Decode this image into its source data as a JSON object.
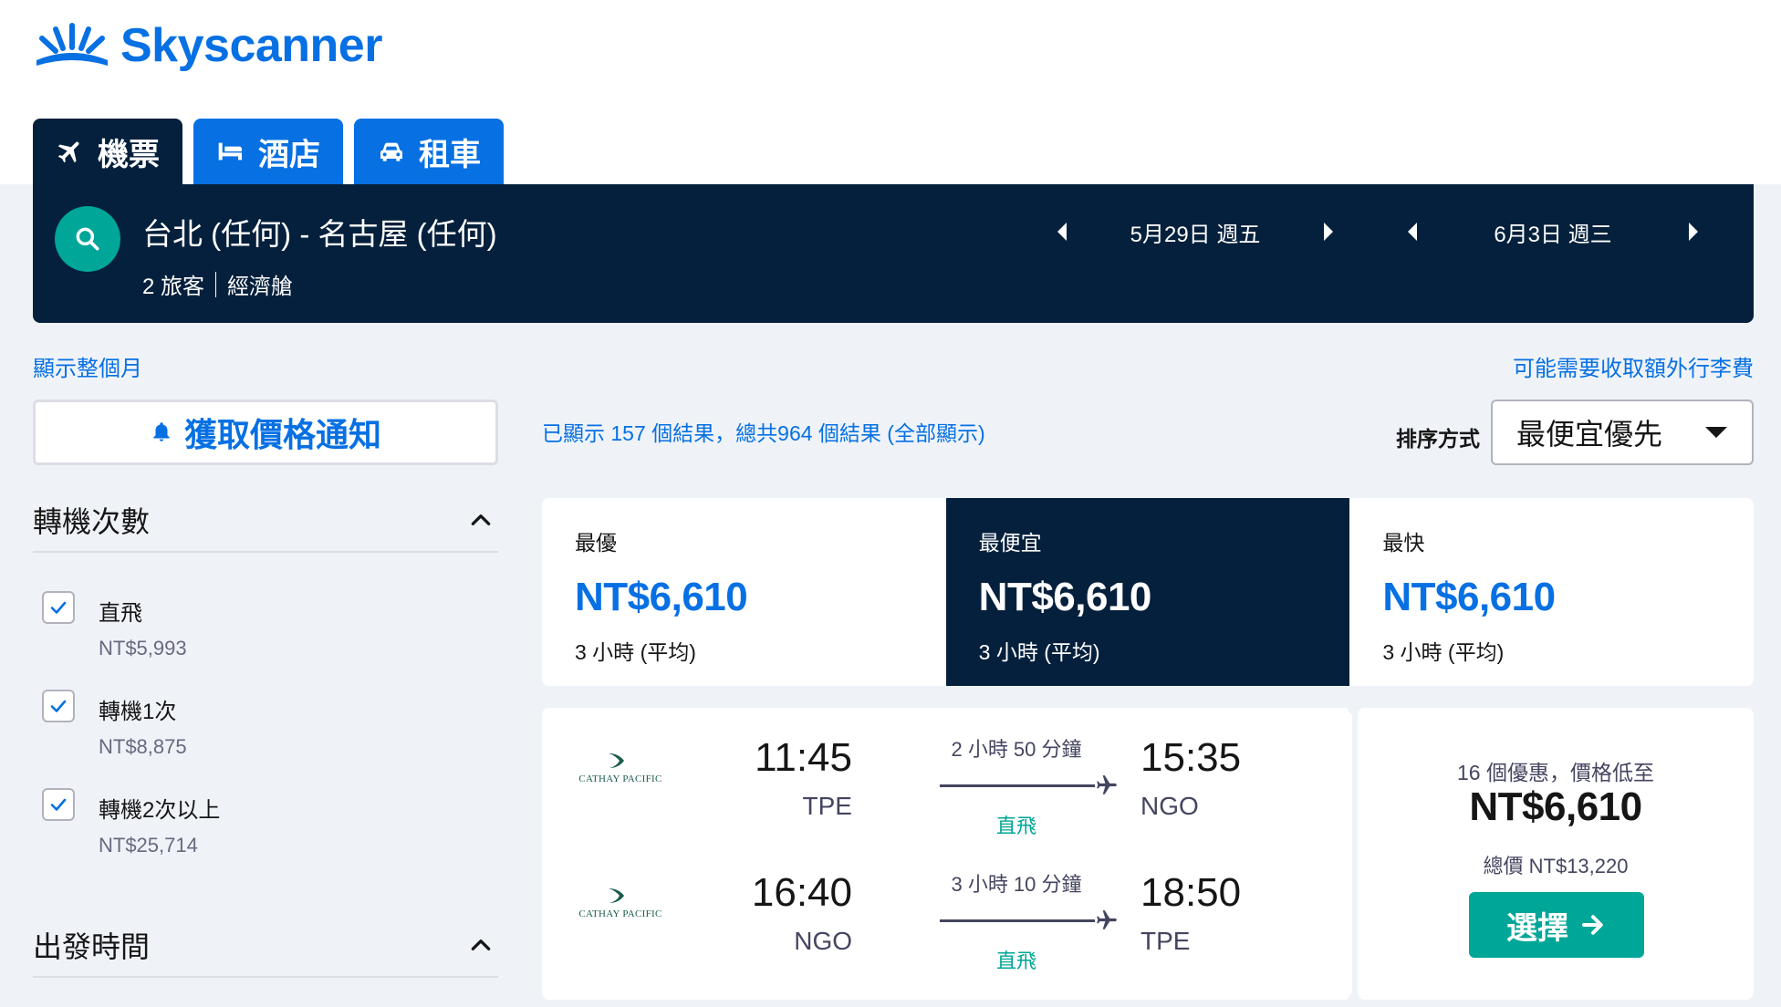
{
  "brand": {
    "name": "Skyscanner",
    "color": "#0770e3"
  },
  "tabs": [
    {
      "label": "機票",
      "icon": "plane-icon",
      "active": true
    },
    {
      "label": "酒店",
      "icon": "bed-icon",
      "active": false
    },
    {
      "label": "租車",
      "icon": "car-icon",
      "active": false
    }
  ],
  "search": {
    "route": "台北 (任何) - 名古屋 (任何)",
    "travelers": "2 旅客",
    "cabin": "經濟艙",
    "depart_date": "5月29日 週五",
    "return_date": "6月3日 週三"
  },
  "links": {
    "show_month": "顯示整個月",
    "baggage_fee": "可能需要收取額外行李費"
  },
  "price_alert": {
    "label": "獲取價格通知"
  },
  "results": {
    "count_text": "已顯示 157 個結果，總共964 個結果 (全部顯示)",
    "sort_label": "排序方式",
    "sort_value": "最便宜優先"
  },
  "filters": {
    "stops_title": "轉機次數",
    "stops": [
      {
        "label": "直飛",
        "price": "NT$5,993",
        "checked": true
      },
      {
        "label": "轉機1次",
        "price": "NT$8,875",
        "checked": true
      },
      {
        "label": "轉機2次以上",
        "price": "NT$25,714",
        "checked": true
      }
    ],
    "departure_title": "出發時間"
  },
  "sort_tabs": [
    {
      "label": "最優",
      "price": "NT$6,610",
      "duration": "3 小時 (平均)",
      "active": false
    },
    {
      "label": "最便宜",
      "price": "NT$6,610",
      "duration": "3 小時 (平均)",
      "active": true
    },
    {
      "label": "最快",
      "price": "NT$6,610",
      "duration": "3 小時 (平均)",
      "active": false
    }
  ],
  "ticket": {
    "legs": [
      {
        "airline": "CATHAY PACIFIC",
        "dep_time": "11:45",
        "dep_code": "TPE",
        "duration": "2 小時 50 分鐘",
        "stops": "直飛",
        "arr_time": "15:35",
        "arr_code": "NGO"
      },
      {
        "airline": "CATHAY PACIFIC",
        "dep_time": "16:40",
        "dep_code": "NGO",
        "duration": "3 小時 10 分鐘",
        "stops": "直飛",
        "arr_time": "18:50",
        "arr_code": "TPE"
      }
    ],
    "deals": "16 個優惠，價格低至",
    "price": "NT$6,610",
    "total": "總價 NT$13,220",
    "select_label": "選擇"
  },
  "colors": {
    "navy": "#05203c",
    "blue": "#0770e3",
    "teal": "#00a698",
    "background": "#eff3f8"
  }
}
